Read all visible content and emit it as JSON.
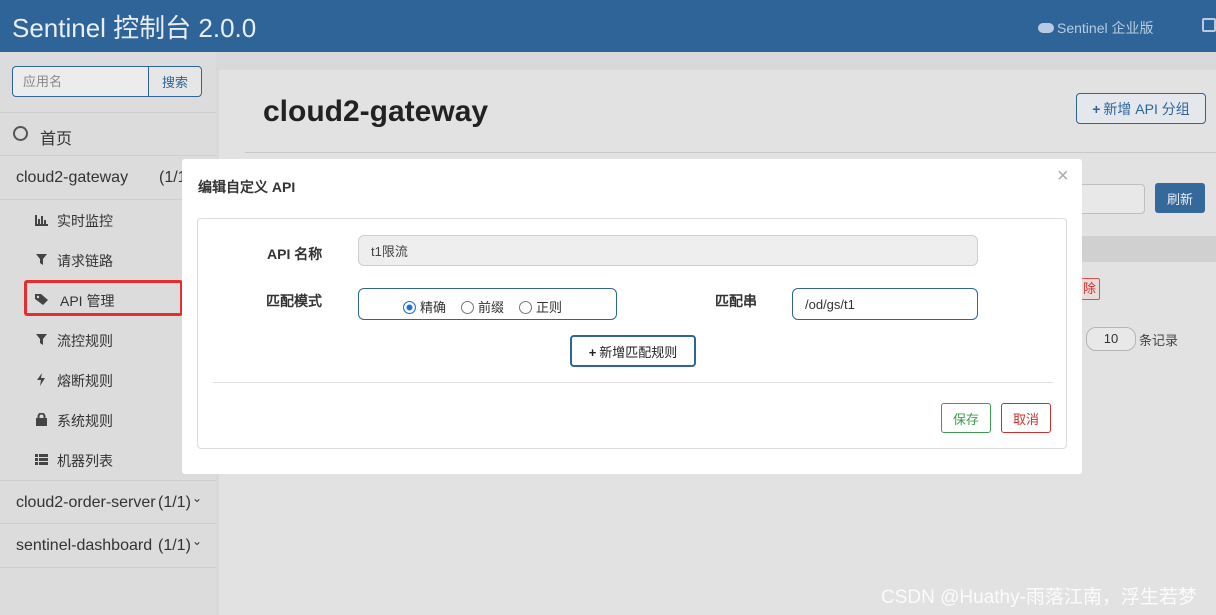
{
  "header": {
    "title": "Sentinel 控制台 2.0.0",
    "enterprise_link": "Sentinel 企业版",
    "logout_icon": "sign-out-icon",
    "cloud_icon": "cloud-icon"
  },
  "sidebar": {
    "search": {
      "placeholder": "应用名",
      "button": "搜索"
    },
    "home": {
      "label": "首页",
      "icon": "dashboard-icon"
    },
    "apps": [
      {
        "name": "cloud2-gateway",
        "count": "(1/1)"
      },
      {
        "name": "cloud2-order-server",
        "count": "(1/1)"
      },
      {
        "name": "sentinel-dashboard",
        "count": "(1/1)"
      }
    ],
    "items": [
      {
        "label": "实时监控",
        "icon": "bar-chart-icon"
      },
      {
        "label": "请求链路",
        "icon": "filter-icon"
      },
      {
        "label": "API 管理",
        "icon": "tags-icon"
      },
      {
        "label": "流控规则",
        "icon": "filter-icon"
      },
      {
        "label": "熔断规则",
        "icon": "flash-icon"
      },
      {
        "label": "系统规则",
        "icon": "lock-icon"
      },
      {
        "label": "机器列表",
        "icon": "list-icon"
      }
    ],
    "highlight_color": "#e52e2e"
  },
  "main": {
    "title": "cloud2-gateway",
    "add_group_button": "新增 API 分组",
    "refresh_button": "刷新",
    "delete_button": "除",
    "page_size": "10",
    "records_label": "条记录"
  },
  "modal": {
    "title": "编辑自定义 API",
    "close": "×",
    "api_name_label": "API 名称",
    "api_name_value": "t1限流",
    "match_mode_label": "匹配模式",
    "modes": [
      "精确",
      "前缀",
      "正则"
    ],
    "selected_mode": "精确",
    "pattern_label": "匹配串",
    "pattern_value": "/od/gs/t1",
    "add_rule_button": "新增匹配规则",
    "save_button": "保存",
    "cancel_button": "取消"
  },
  "watermark": "CSDN @Huathy-雨落江南，浮生若梦",
  "colors": {
    "header_bg": "#2f6499",
    "primary": "#2f6499",
    "success": "#3c9d4e",
    "danger": "#c9302c"
  }
}
